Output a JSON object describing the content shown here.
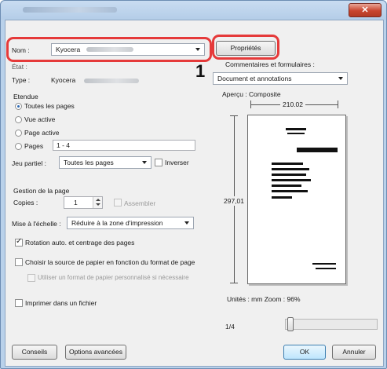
{
  "callout": "1",
  "printer": {
    "name_label": "Nom :",
    "name_value": "Kyocera",
    "status_label": "État :",
    "type_label": "Type :",
    "type_value": "Kyocera",
    "properties_button": "Propriétés"
  },
  "comments": {
    "label": "Commentaires et formulaires :",
    "value": "Document et annotations"
  },
  "range": {
    "title": "Etendue",
    "all_pages": "Toutes les pages",
    "current_view": "Vue active",
    "current_page": "Page active",
    "pages_label": "Pages",
    "pages_value": "1 - 4",
    "subset_label": "Jeu partiel :",
    "subset_value": "Toutes les pages",
    "reverse_label": "Inverser"
  },
  "handling": {
    "title": "Gestion de la page",
    "copies_label": "Copies :",
    "copies_value": "1",
    "collate_label": "Assembler",
    "scaling_label": "Mise à l'échelle :",
    "scaling_value": "Réduire à la zone d'impression",
    "autorotate_label": "Rotation auto. et centrage des pages",
    "paper_source_label": "Choisir la source de papier en fonction du format de page",
    "custom_paper_label": "Utiliser un format de papier personnalisé si nécessaire"
  },
  "print_to_file": "Imprimer dans un fichier",
  "preview": {
    "title": "Aperçu : Composite",
    "width": "210.02",
    "height": "297,01",
    "units": "Unités : mm Zoom : 96%",
    "page_counter": "1/4"
  },
  "footer": {
    "tips_button": "Conseils",
    "advanced_button": "Options avancées",
    "ok_button": "OK",
    "cancel_button": "Annuler"
  },
  "colors": {
    "highlight": "#e53a3a",
    "accent": "#2a67b2"
  }
}
